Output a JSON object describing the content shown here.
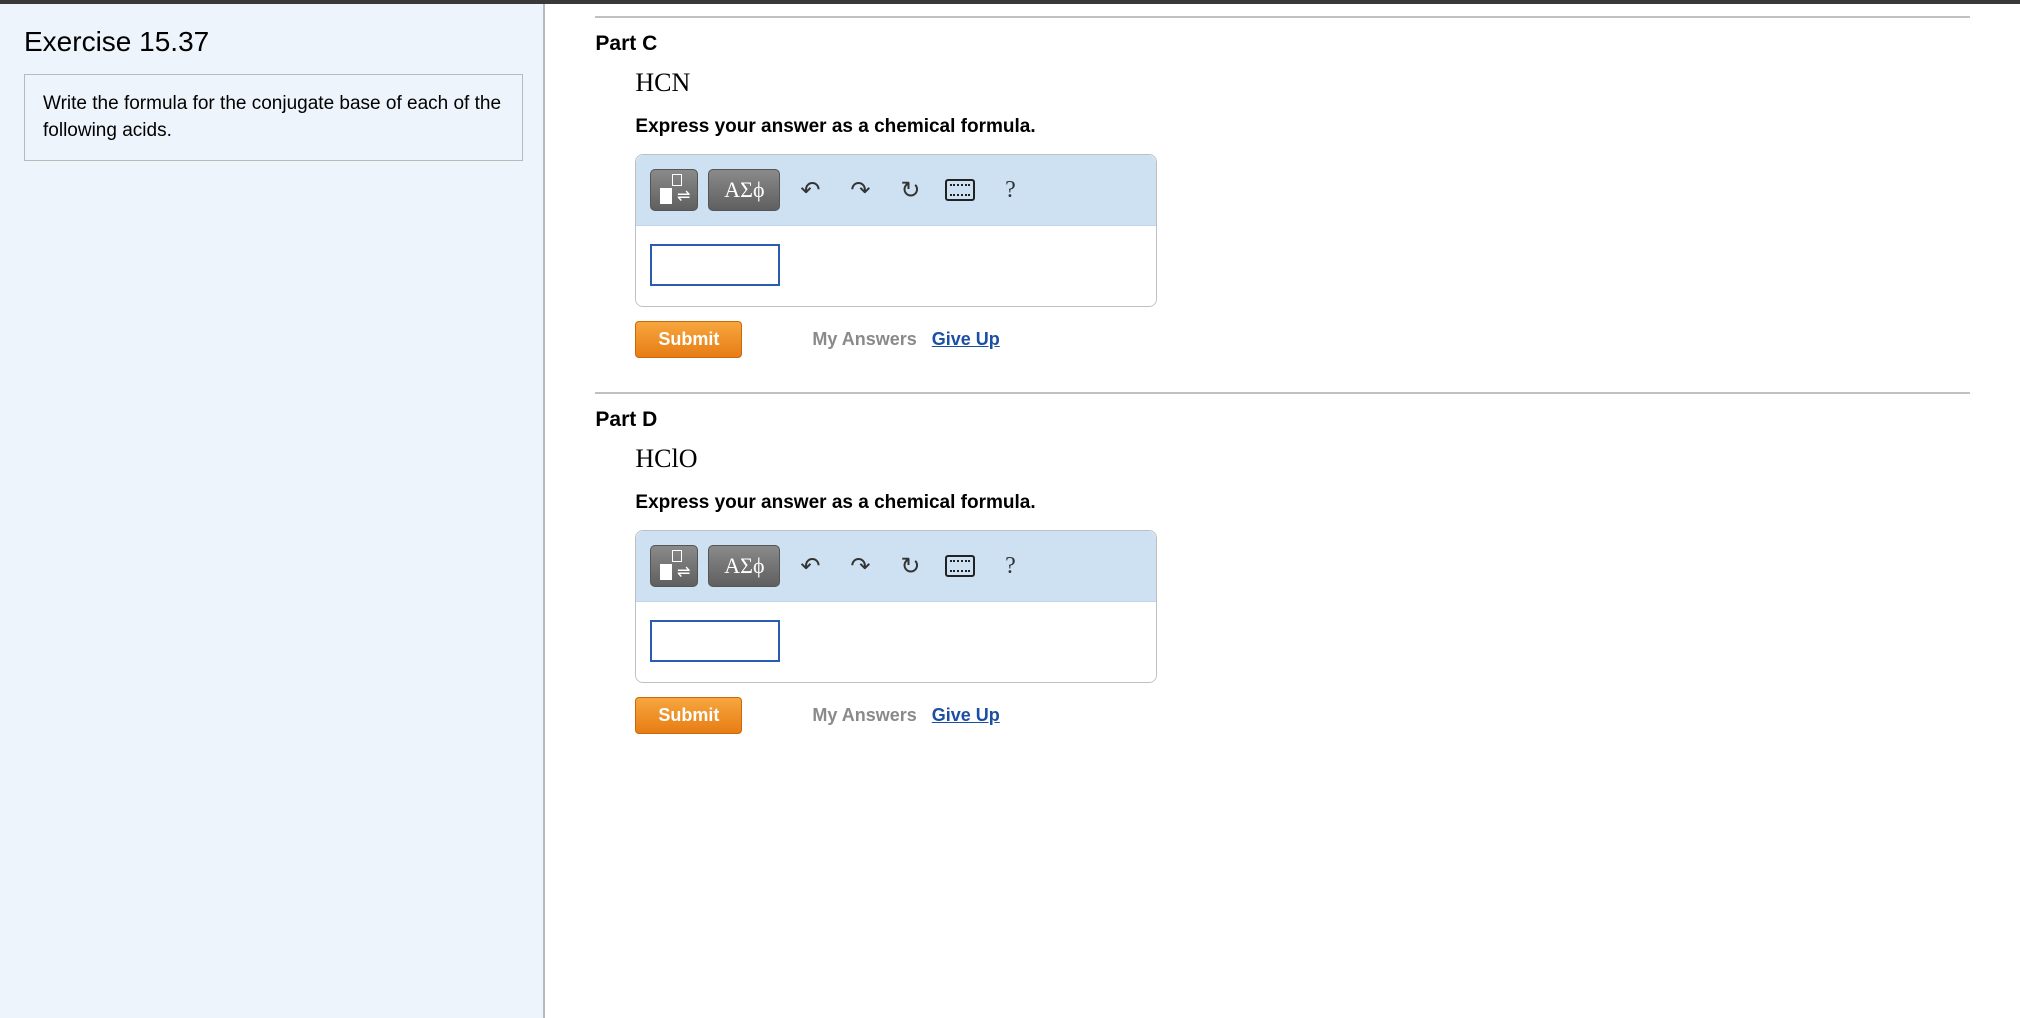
{
  "left": {
    "exercise_title": "Exercise 15.37",
    "instructions": "Write the formula for the conjugate base of each of the following acids."
  },
  "toolbar": {
    "greek_label": "ΑΣϕ",
    "undo_glyph": "↶",
    "redo_glyph": "↷",
    "reset_glyph": "↻",
    "help_glyph": "?"
  },
  "parts": {
    "c": {
      "title": "Part C",
      "chem": "HCN",
      "instruction": "Express your answer as a chemical formula.",
      "submit": "Submit",
      "my_answers": "My Answers",
      "give_up": "Give Up"
    },
    "d": {
      "title": "Part D",
      "chem": "HClO",
      "instruction": "Express your answer as a chemical formula.",
      "submit": "Submit",
      "my_answers": "My Answers",
      "give_up": "Give Up"
    }
  }
}
